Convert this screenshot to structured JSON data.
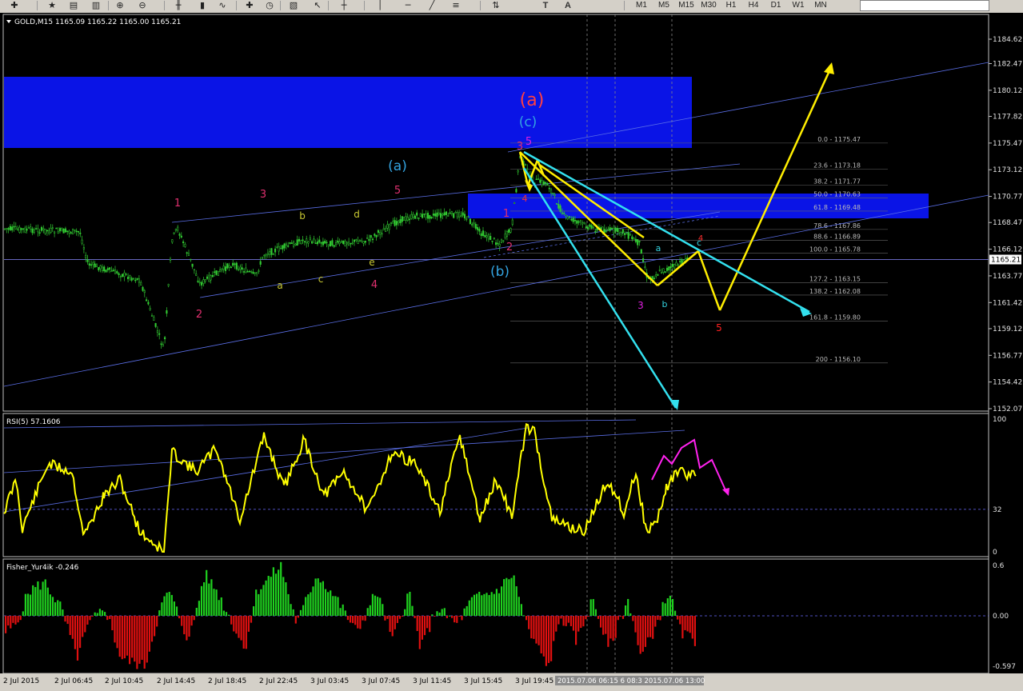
{
  "toolbar": {
    "timeframes": [
      "M1",
      "M5",
      "M15",
      "M30",
      "H1",
      "H4",
      "D1",
      "W1",
      "MN"
    ],
    "letter_tools": [
      "T",
      "A"
    ],
    "icons": [
      "new-order-icon",
      "favorites-icon",
      "templates-icon",
      "profiles-icon",
      "zoom-in-icon",
      "zoom-out-icon",
      "chart-bars-icon",
      "chart-candles-icon",
      "chart-line-icon",
      "indicators-icon",
      "periods-icon",
      "templates-dropdown-icon",
      "cursor-icon",
      "crosshair-icon",
      "vertical-line-icon",
      "horizontal-line-icon",
      "trendline-icon",
      "fibonacci-icon",
      "arrows-icon"
    ]
  },
  "main_pane": {
    "header": "GOLD,M15  1165.09 1165.22 1165.00 1165.21",
    "current_price": "1165.21",
    "price_ticks": [
      "1184.62",
      "1182.47",
      "1180.12",
      "1177.82",
      "1175.47",
      "1173.12",
      "1170.77",
      "1168.47",
      "1166.12",
      "1163.77",
      "1161.42",
      "1159.12",
      "1156.77",
      "1154.42",
      "1152.07"
    ],
    "fib_levels": [
      "0.0 - 1175.47",
      "23.6 - 1173.18",
      "38.2 - 1171.77",
      "50.0 - 1170.63",
      "61.8 - 1169.48",
      "78.6 - 1167.86",
      "88.6 - 1166.89",
      "100.0 - 1165.78",
      "127.2 - 1163.15",
      "138.2 - 1162.08",
      "161.8 - 1159.80",
      "200 - 1156.10"
    ],
    "wave_labels": [
      {
        "text": "1",
        "color": "#e0306f"
      },
      {
        "text": "2",
        "color": "#e0306f"
      },
      {
        "text": "3",
        "color": "#e0306f"
      },
      {
        "text": "4",
        "color": "#e0306f"
      },
      {
        "text": "5",
        "color": "#e0306f"
      },
      {
        "text": "a",
        "color": "#c8c832"
      },
      {
        "text": "b",
        "color": "#c8c832"
      },
      {
        "text": "c",
        "color": "#c8c832"
      },
      {
        "text": "d",
        "color": "#c8c832"
      },
      {
        "text": "e",
        "color": "#c8c832"
      },
      {
        "text": "(a)",
        "color": "#33a3e0"
      },
      {
        "text": "(b)",
        "color": "#33a3e0"
      },
      {
        "text": "(c)",
        "color": "#33a3e0"
      },
      {
        "text": "(a)",
        "color": "#ff4040"
      },
      {
        "text": "1",
        "color": "#e0306f"
      },
      {
        "text": "2",
        "color": "#e0306f"
      },
      {
        "text": "3",
        "color": "#e0306f"
      },
      {
        "text": "4",
        "color": "#ff3030"
      },
      {
        "text": "5",
        "color": "#e020e0"
      },
      {
        "text": "3",
        "color": "#e020e0"
      },
      {
        "text": "a",
        "color": "#33d3e0"
      },
      {
        "text": "b",
        "color": "#33d3e0"
      },
      {
        "text": "c",
        "color": "#33d3e0"
      },
      {
        "text": "5",
        "color": "#ff2020"
      },
      {
        "text": "4",
        "color": "#ff3030"
      }
    ]
  },
  "rsi_pane": {
    "header": "RSI(5) 57.1606",
    "ticks": [
      "100",
      "32",
      "0"
    ]
  },
  "fisher_pane": {
    "header": "Fisher_Yur4ik -0.246",
    "ticks": [
      "0.6",
      "0.00",
      "-0.597"
    ]
  },
  "time_axis": {
    "labels": [
      "2 Jul 2015",
      "2 Jul 06:45",
      "2 Jul 10:45",
      "2 Jul 14:45",
      "2 Jul 18:45",
      "2 Jul 22:45",
      "3 Jul 03:45",
      "3 Jul 07:45",
      "3 Jul 11:45",
      "3 Jul 15:45",
      "3 Jul 19:45"
    ],
    "highlight": "2015.07.06 06:15 6 08:3 2015.07.06 13:00"
  },
  "colors": {
    "background": "#000000",
    "candles": "#32cd32",
    "zones": "#0a14e6",
    "rsi": "#ffff00",
    "fisher_up": "#1fd11f",
    "fisher_down": "#e01010",
    "channel": "#5a6ee6",
    "projection_yellow": "#ffee00",
    "projection_cyan": "#33e0ee",
    "projection_magenta": "#ff22ee"
  }
}
